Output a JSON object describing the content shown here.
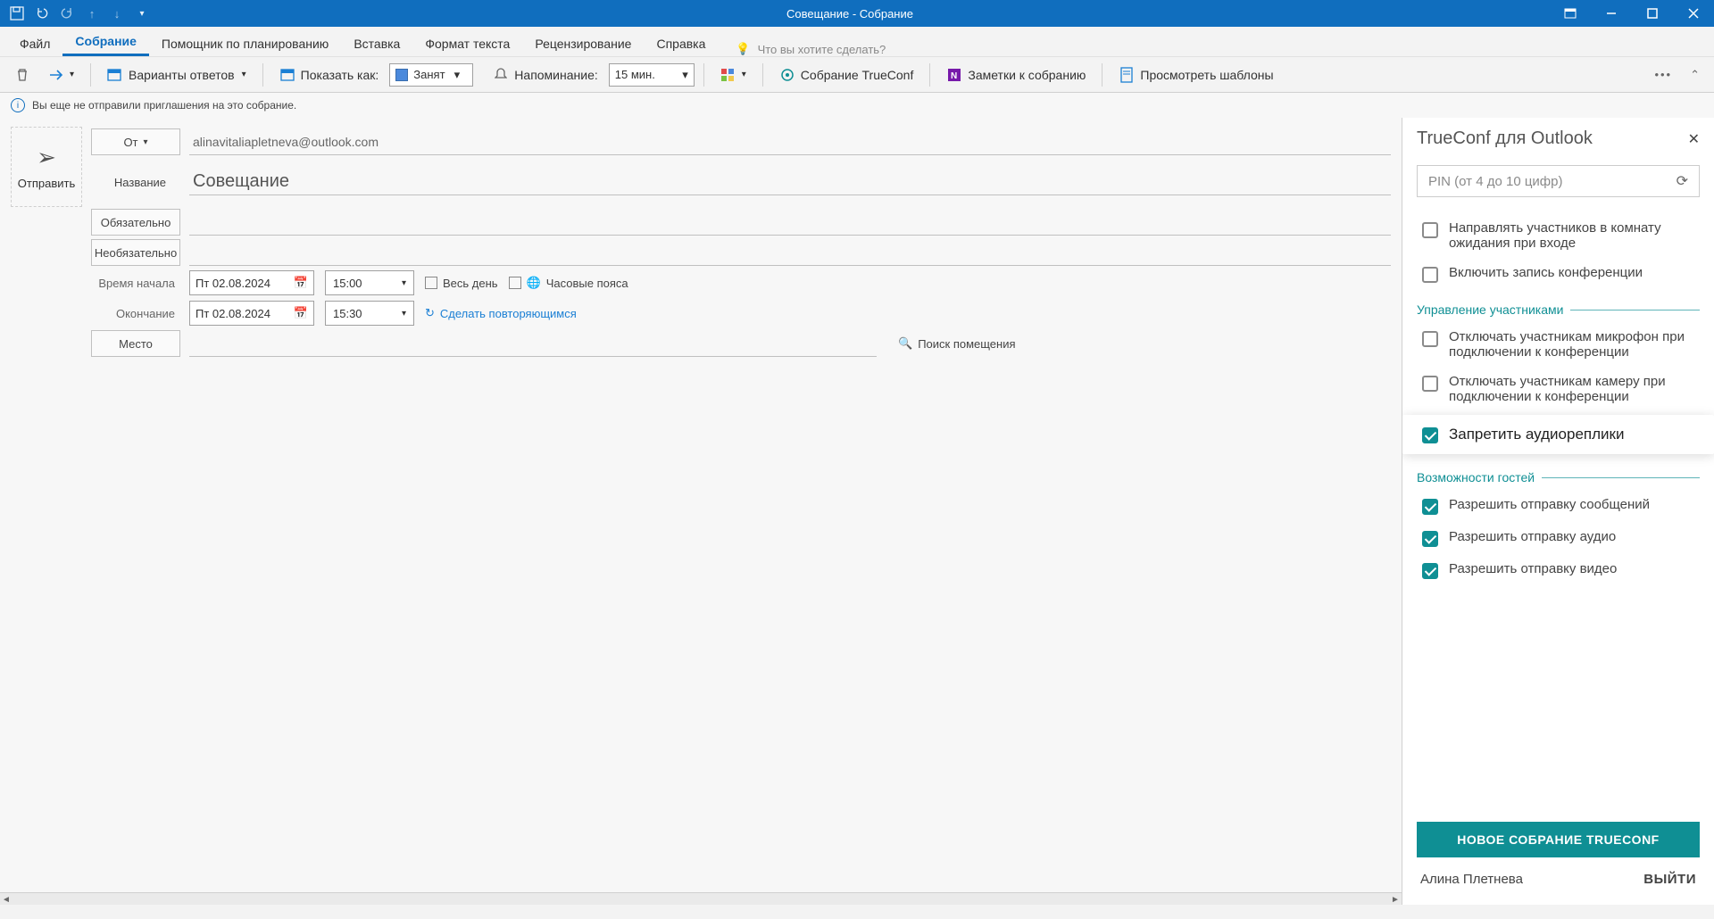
{
  "titlebar": {
    "title": "Совещание  -  Собрание"
  },
  "tabs": {
    "file": "Файл",
    "meeting": "Собрание",
    "assistant": "Помощник по планированию",
    "insert": "Вставка",
    "format": "Формат текста",
    "review": "Рецензирование",
    "help": "Справка",
    "tellme": "Что вы хотите сделать?"
  },
  "toolbar": {
    "response": "Варианты ответов",
    "showas_label": "Показать как:",
    "showas_value": "Занят",
    "reminder_label": "Напоминание:",
    "reminder_value": "15 мин.",
    "trueconf_meeting": "Собрание TrueConf",
    "meeting_notes": "Заметки к собранию",
    "view_templates": "Просмотреть шаблоны"
  },
  "info": "Вы еще не отправили приглашения на это собрание.",
  "form": {
    "send": "Отправить",
    "from_label": "От",
    "from_value": "alinavitaliapletneva@outlook.com",
    "name_label": "Название",
    "name_value": "Совещание",
    "required": "Обязательно",
    "optional": "Необязательно",
    "start_label": "Время начала",
    "end_label": "Окончание",
    "start_date": "Пт 02.08.2024",
    "start_time": "15:00",
    "end_date": "Пт 02.08.2024",
    "end_time": "15:30",
    "all_day": "Весь день",
    "timezones": "Часовые пояса",
    "recurring": "Сделать повторяющимся",
    "location": "Место",
    "find_room": "Поиск помещения"
  },
  "tc": {
    "title": "TrueConf для Outlook",
    "pin_placeholder": "PIN (от 4 до 10 цифр)",
    "opt_waiting": "Направлять участников в комнату ожидания при входе",
    "opt_record": "Включить запись конференции",
    "section_manage": "Управление участниками",
    "opt_mute_mic": "Отключать участникам микрофон при подключении к конференции",
    "opt_mute_cam": "Отключать участникам камеру при подключении к конференции",
    "opt_audio_block": "Запретить аудиореплики",
    "section_guests": "Возможности гостей",
    "opt_msg": "Разрешить отправку сообщений",
    "opt_audio": "Разрешить отправку аудио",
    "opt_video": "Разрешить отправку видео",
    "main_btn": "НОВОЕ СОБРАНИЕ TRUECONF",
    "user": "Алина Плетнева",
    "logout": "ВЫЙТИ"
  }
}
